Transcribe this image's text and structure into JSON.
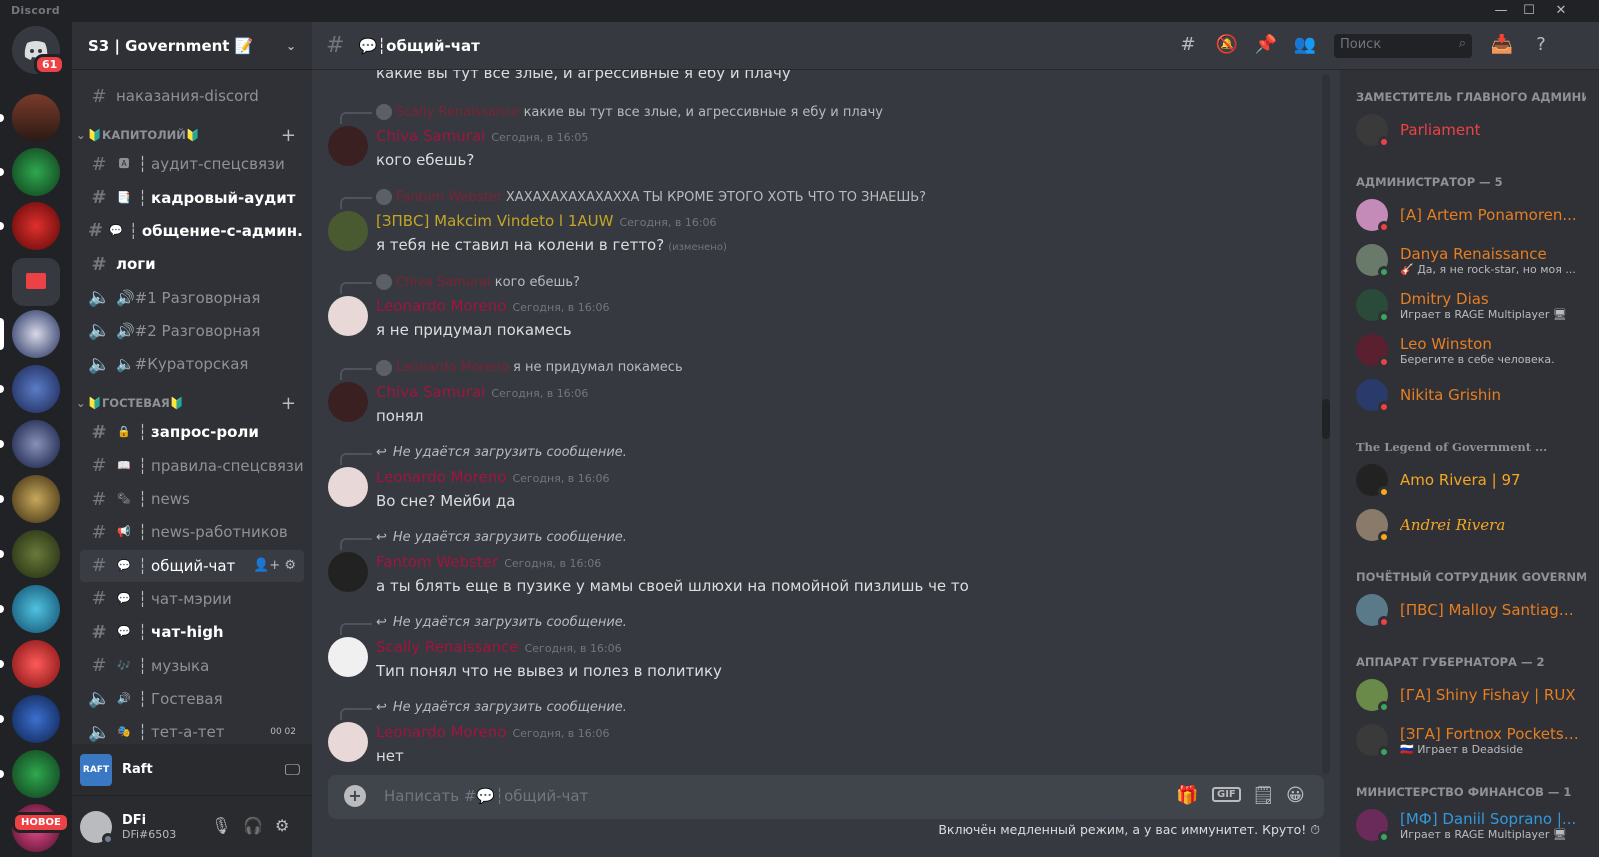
{
  "app": {
    "brand": "Discord",
    "min_icon": "minimize-icon",
    "max_icon": "maximize-icon",
    "close_icon": "close-icon"
  },
  "servers": {
    "home_badge": "61",
    "new_label": "НОВОЕ"
  },
  "guild": {
    "name": "S3 | Government 📝",
    "channels": [
      {
        "label": "наказания-discord",
        "type": "text",
        "emoji": "",
        "state": "normal"
      },
      {
        "category": "🔰КАПИТОЛИЙ🔰"
      },
      {
        "label": "аудит-спецсвязи",
        "type": "text",
        "emoji": "🅰",
        "state": "normal"
      },
      {
        "label": "кадровый-аудит",
        "type": "text",
        "emoji": "📑",
        "state": "unread"
      },
      {
        "label": "общение-с-админ...",
        "type": "text",
        "emoji": "💬",
        "state": "unread"
      },
      {
        "label": "логи",
        "type": "text",
        "emoji": "",
        "state": "unread"
      },
      {
        "label": "🔊#1 Разговорная",
        "type": "voice",
        "emoji": "",
        "state": "normal"
      },
      {
        "label": "🔊#2 Разговорная",
        "type": "voice",
        "emoji": "",
        "state": "normal"
      },
      {
        "label": "🔈#Кураторская",
        "type": "voice",
        "emoji": "",
        "state": "normal"
      },
      {
        "category": "🔰ГОСТЕВАЯ🔰"
      },
      {
        "label": "запрос-роли",
        "type": "text",
        "emoji": "🔒",
        "state": "unread"
      },
      {
        "label": "правила-спецсвязи",
        "type": "text",
        "emoji": "📖",
        "state": "normal"
      },
      {
        "label": "news",
        "type": "text",
        "emoji": "🗞",
        "state": "normal"
      },
      {
        "label": "news-работников",
        "type": "text",
        "emoji": "📢",
        "state": "normal"
      },
      {
        "label": "общий-чат",
        "type": "text",
        "emoji": "💬",
        "state": "active"
      },
      {
        "label": "чат-мэрии",
        "type": "text",
        "emoji": "💬",
        "state": "normal"
      },
      {
        "label": "чат-high",
        "type": "text",
        "emoji": "💬",
        "state": "unread"
      },
      {
        "label": "музыка",
        "type": "text",
        "emoji": "🎶",
        "state": "normal"
      },
      {
        "label": "Гостевая",
        "type": "voice",
        "emoji": "🔊",
        "state": "normal"
      },
      {
        "label": "тет-а-тет",
        "type": "voice",
        "emoji": "🎭",
        "state": "normal",
        "pips": "00  02"
      }
    ]
  },
  "activity": {
    "logo": "RAFT",
    "name": "Raft"
  },
  "user": {
    "name": "DFi",
    "tag": "DFi#6503"
  },
  "chat": {
    "channel": "💬┆общий-чат",
    "search_placeholder": "Поиск",
    "composer_placeholder": "Написать #💬┆общий-чат",
    "slowmode": "Включён медленный режим, а у вас иммунитет. Круто! ⏱",
    "top_line": "какие вы тут все злые, и агрессивные я ебу и плачу",
    "messages": [
      {
        "reply_name": "Scally Renaissance",
        "reply_text": "какие вы тут все злые, и агрессивные я ебу и плачу",
        "author": "Chiva Samurai",
        "time": "Сегодня, в 16:05",
        "text": "кого ебешь?",
        "color": "#a0153e"
      },
      {
        "reply_name": "Fantom Webster",
        "reply_text": "ХАХАХАХАХАХАХХА ТЫ КРОМЕ ЭТОГО ХОТЬ ЧТО ТО ЗНАЕШЬ?",
        "author": "[ЗПВС] Makcim Vindeto l 1AUW",
        "time": "Сегодня, в 16:06",
        "text": "я тебя не ставил на колени в гетто?",
        "edited": "(изменено)",
        "color": "gold"
      },
      {
        "reply_name": "Chiva Samurai",
        "reply_text": "кого ебешь?",
        "author": "Leonardo Moreno",
        "time": "Сегодня, в 16:06",
        "text": "я не придумал покамесь",
        "color": "#a0153e"
      },
      {
        "reply_name": "Leonardo Moreno",
        "reply_text": "я не придумал покамесь",
        "author": "Chiva Samurai",
        "time": "Сегодня, в 16:06",
        "text": "понял",
        "color": "#a0153e"
      },
      {
        "reply_failed": "Не удаётся загрузить сообщение.",
        "author": "Leonardo Moreno",
        "time": "Сегодня, в 16:06",
        "text": "Во сне? Мейби да",
        "color": "#a0153e"
      },
      {
        "reply_failed": "Не удаётся загрузить сообщение.",
        "author": "Fantom Webster",
        "time": "Сегодня, в 16:06",
        "text": "а ты блять еще в пузике у мамы своей шлюхи на помойной пизлишь че то",
        "color": "#a0153e"
      },
      {
        "reply_failed": "Не удаётся загрузить сообщение.",
        "author": "Scally Renaissance",
        "time": "Сегодня, в 16:06",
        "text": "Тип понял что не вывез и полез в политику",
        "color": "#a0153e"
      },
      {
        "reply_failed": "Не удаётся загрузить сообщение.",
        "author": "Leonardo Moreno",
        "time": "Сегодня, в 16:06",
        "text": "нет",
        "color": "#a0153e"
      }
    ]
  },
  "members": {
    "groups": [
      {
        "title": "ЗАМЕСТИТЕЛЬ ГЛАВНОГО АДМИНИ...",
        "members": [
          {
            "name": "Parliament",
            "sub": "",
            "color": "#ed4245",
            "status": "#ed4245"
          }
        ]
      },
      {
        "title": "АДМИНИСТРАТОР — 5",
        "members": [
          {
            "name": "[A] Artem Ponamoren...",
            "sub": "",
            "color": "#e67e22",
            "status": "#ed4245"
          },
          {
            "name": "Danya Renaissance",
            "sub": "🎸 Да, я не rock-star, но моя ...",
            "color": "#e67e22",
            "status": "#3ba55d"
          },
          {
            "name": "Dmitry Dias",
            "sub": "Играет в RAGE Multiplayer 🖥",
            "color": "#e67e22",
            "status": "#3ba55d"
          },
          {
            "name": "Leo Winston",
            "sub": "Берегите в себе человека.",
            "color": "#e67e22",
            "status": "#ed4245"
          },
          {
            "name": "Nikita Grishin",
            "sub": "",
            "color": "#e67e22",
            "status": "#ed4245"
          }
        ]
      },
      {
        "title": "The Legend of Government ...",
        "members": [
          {
            "name": "Amo Rivera | 97",
            "sub": "",
            "color": "#f5a623",
            "status": "#faa61a"
          },
          {
            "name": "Andrei Rivera",
            "sub": "",
            "color": "#f5a623",
            "status": "#faa61a"
          }
        ]
      },
      {
        "title": "ПОЧЁТНЫЙ СОТРУДНИК Governm...",
        "members": [
          {
            "name": "[ПВС] Malloy Santiago...",
            "sub": "",
            "color": "#e67e22",
            "status": "#ed4245"
          }
        ]
      },
      {
        "title": "АППАРАТ ГУБЕРНАТОРА — 2",
        "members": [
          {
            "name": "[ГА] Shiny Fishay | RUX",
            "sub": "",
            "color": "#e67e22",
            "status": "#3ba55d"
          },
          {
            "name": "[ЗГА] Fortnox Pockets ...",
            "sub": "🇷🇺 Играет в Deadside",
            "color": "#e67e22",
            "status": "#3ba55d"
          }
        ]
      },
      {
        "title": "МИНИСТЕРСТВО ФИНАНСОВ — 1",
        "members": [
          {
            "name": "[МФ] Daniil Soprano |...",
            "sub": "Играет в RAGE Multiplayer 🖥",
            "color": "#3498db",
            "status": "#3ba55d"
          }
        ]
      }
    ]
  }
}
